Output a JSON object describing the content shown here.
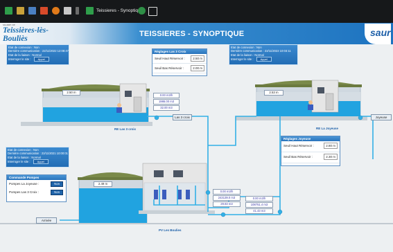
{
  "taskbar": {
    "window_title": "Teissieres - Synoptique"
  },
  "header": {
    "logo_sub": "MAIRIE DE",
    "logo_text": "Teissières-lès-Bouliès",
    "title": "TEISSIERES - SYNOPTIQUE",
    "brand": "saur"
  },
  "info_panels": {
    "top_left": {
      "state": "Etat de connexion : Non",
      "last_comm": "Dernière communication : 22/11/2022 12:08:47",
      "link": "Etat de la liaison : Normal",
      "query": "Interroger le site :",
      "call": "Appel"
    },
    "top_right": {
      "state": "Etat de connexion : Non",
      "last_comm": "Dernière communication : 22/11/2022 10:03:11",
      "link": "Etat de la liaison : Normal",
      "query": "Interroger le site :",
      "call": "Appel"
    },
    "mid_left": {
      "state": "Etat de connexion : Non",
      "last_comm": "Dernière communication : 22/11/2021 10:00:01",
      "link": "Etat de la liaison : Normal",
      "query": "Interroger le site :",
      "call": "Appel"
    }
  },
  "setpoints": {
    "les3croix": {
      "title": "Réglages Las 3 Croix",
      "high_label": "Seuil Haut Réservoir :",
      "high_value": "2.50 m",
      "low_label": "Seuil Bas Réservoir :",
      "low_value": "2.00 m"
    },
    "joyeuse": {
      "title": "Réglages Joyeuse",
      "high_label": "Seuil Haut Réservoir :",
      "high_value": "2.80 m",
      "low_label": "Seuil Bas Réservoir :",
      "low_value": "2.30 m"
    }
  },
  "pump_control": {
    "title": "Commande Pompes",
    "rows": [
      {
        "label": "Pompes La Joyeuse :",
        "state": "Non"
      },
      {
        "label": "Pompes Las 3 Croix :",
        "state": "Non"
      }
    ]
  },
  "sites": {
    "r1": {
      "name": "RE Las 3 croix",
      "level": "2.50 m",
      "flow": "0.00 m3/h",
      "index": "1986.00 m3",
      "daily": "32.00 m3"
    },
    "r2": {
      "name": "RE La Joyeuse",
      "level": "2.53 m"
    },
    "pv": {
      "name": "PV Les Boulies",
      "level": "2.49 m",
      "flow_a": "0.00 m3/h",
      "index_a": "243139.0 m3",
      "daily_a": "29.83 m3",
      "flow_b": "0.00 m3/h",
      "index_b": "108751.4 m3",
      "daily_b": "41.43 m3"
    }
  },
  "pipe_labels": {
    "les3croix": "Las 3 croix",
    "joyeuse": "Joyeuse",
    "arrivee": "Arrivée"
  },
  "colors": {
    "water": "#21a3e0",
    "pipe": "#32b0e6",
    "panel": "#2d7cc4",
    "ground": "#7f8a52"
  }
}
